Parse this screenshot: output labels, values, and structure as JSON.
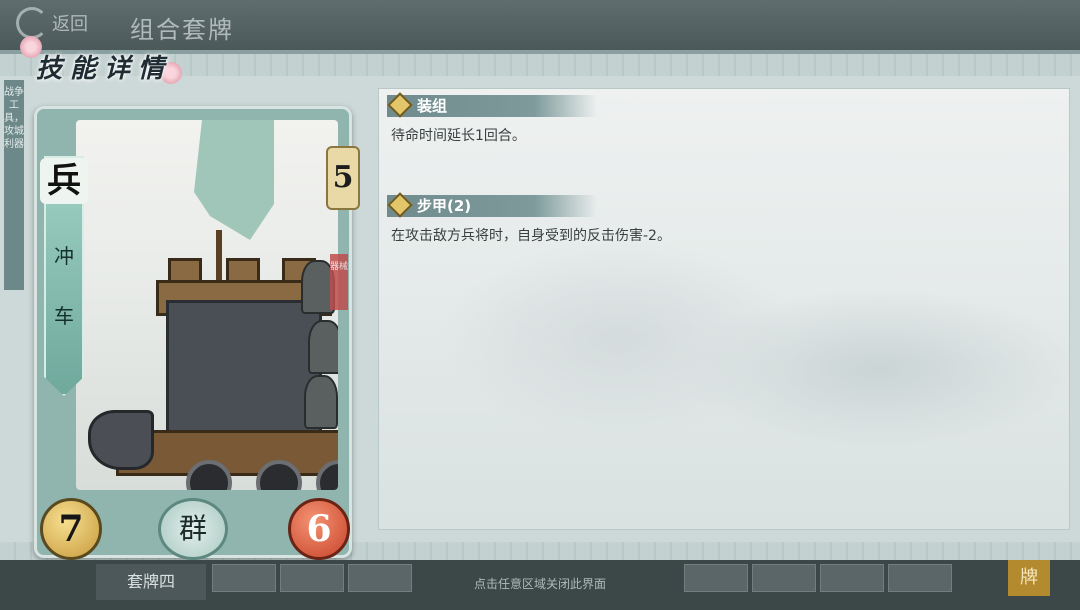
{
  "topbar": {
    "back_label": "返回",
    "title": "组合套牌"
  },
  "dialog": {
    "title": "技能详情",
    "side_text": "战争工具，攻城利器"
  },
  "card": {
    "type_char": "兵",
    "name": [
      "冲",
      "车"
    ],
    "cost": "5",
    "tag": "器械",
    "attack": "7",
    "health": "6",
    "faction": "群"
  },
  "skills": [
    {
      "name": "装组",
      "desc": "待命时间延长1回合。"
    },
    {
      "name": "步甲(2)",
      "desc": "在攻击敌方兵将时，自身受到的反击伤害-2。"
    }
  ],
  "bottombar": {
    "deck_name": "套牌四",
    "close_hint": "点击任意区域关闭此界面",
    "card_button": "牌"
  },
  "colors": {
    "accent": "#6f8b8d",
    "card_frame": "#8fb5ae",
    "attack": "#e6c36a",
    "health": "#d9583a"
  }
}
